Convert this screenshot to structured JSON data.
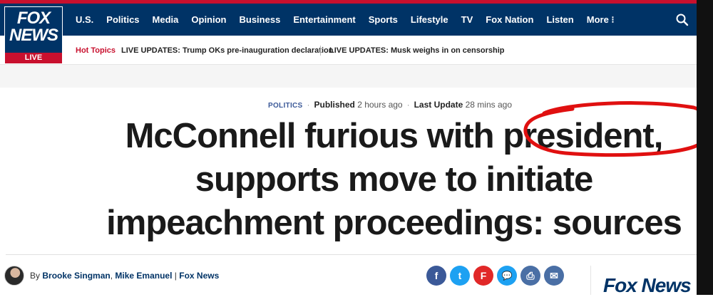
{
  "logo": {
    "line1": "FOX",
    "line2": "NEWS",
    "live": "LIVE"
  },
  "nav": [
    "U.S.",
    "Politics",
    "Media",
    "Opinion",
    "Business",
    "Entertainment",
    "Sports",
    "Lifestyle",
    "TV",
    "Fox Nation",
    "Listen",
    "More ⁝"
  ],
  "hot_topics": {
    "label": "Hot Topics",
    "items": [
      "LIVE UPDATES: Trump OKs pre-inauguration declaration",
      "LIVE UPDATES: Musk weighs in on censorship"
    ]
  },
  "article": {
    "category": "POLITICS",
    "published_label": "Published",
    "published_value": "2 hours ago",
    "updated_label": "Last Update",
    "updated_value": "28 mins ago",
    "headline_line1": "McConnell furious with president,",
    "headline_line2": "supports move to initiate",
    "headline_line3": "impeachment proceedings: sources",
    "byline_prefix": "By",
    "author1": "Brooke Singman",
    "author_sep": ",",
    "author2": "Mike Emanuel",
    "outlet_sep": "|",
    "outlet": "Fox News"
  },
  "share": [
    {
      "icon": "facebook-icon",
      "glyph": "f",
      "color": "#3b5998"
    },
    {
      "icon": "twitter-icon",
      "glyph": "t",
      "color": "#1da1f2"
    },
    {
      "icon": "flipboard-icon",
      "glyph": "F",
      "color": "#e12828"
    },
    {
      "icon": "comment-icon",
      "glyph": "💬",
      "color": "#1da1f2"
    },
    {
      "icon": "print-icon",
      "glyph": "⎙",
      "color": "#4a6fa5"
    },
    {
      "icon": "email-icon",
      "glyph": "✉",
      "color": "#4a6fa5"
    }
  ],
  "rail_ad": {
    "text": "Fox News"
  },
  "colors": {
    "brand_blue": "#003366",
    "brand_red": "#c8102e",
    "annotation_red": "#e01010"
  }
}
